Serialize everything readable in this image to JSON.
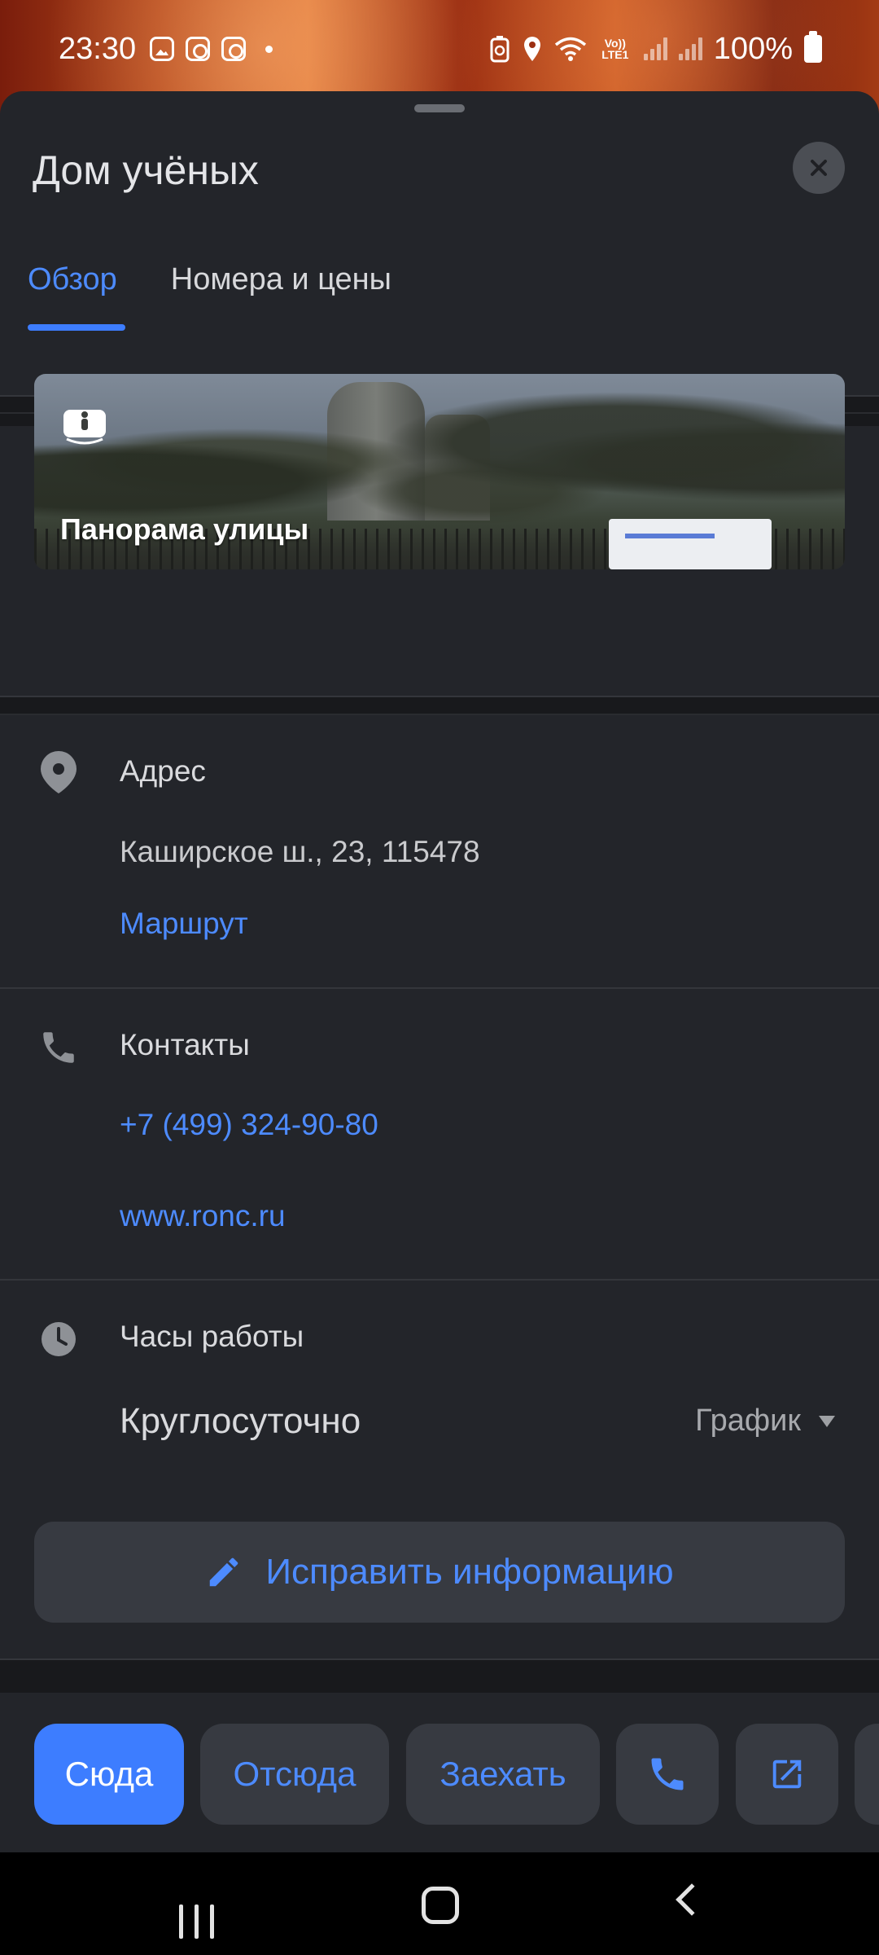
{
  "status_bar": {
    "time": "23:30",
    "battery": "100%",
    "network": "Vo)) LTE1"
  },
  "sheet": {
    "title": "Дом учёных",
    "tabs": [
      {
        "label": "Обзор",
        "active": true
      },
      {
        "label": "Номера и цены",
        "active": false
      }
    ]
  },
  "panorama": {
    "label": "Панорама улицы"
  },
  "address": {
    "heading": "Адрес",
    "value": "Каширское ш., 23, 115478",
    "route_link": "Маршрут"
  },
  "contacts": {
    "heading": "Контакты",
    "phone": "+7 (499) 324-90-80",
    "website": "www.ronc.ru"
  },
  "hours": {
    "heading": "Часы работы",
    "value": "Круглосуточно",
    "schedule_label": "График"
  },
  "edit_button": {
    "label": "Исправить информацию"
  },
  "actions": {
    "to_here": "Сюда",
    "from_here": "Отсюда",
    "via": "Заехать"
  },
  "colors": {
    "accent": "#3d7dff",
    "link": "#4d8bff",
    "sheet_bg": "#23252a",
    "button_bg": "#373a41"
  }
}
